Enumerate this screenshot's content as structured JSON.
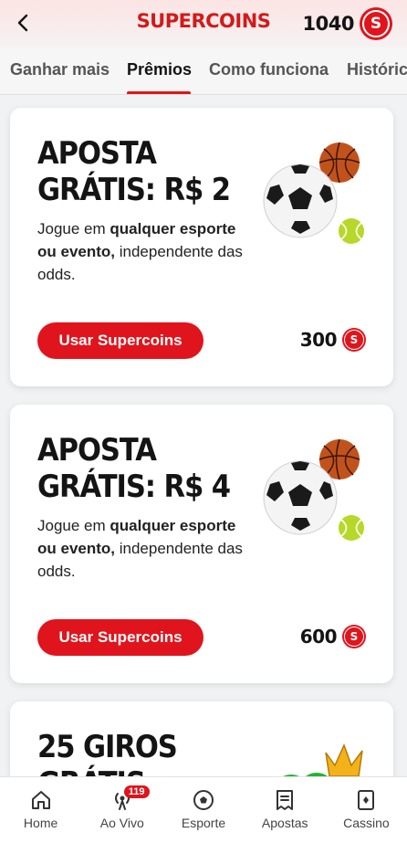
{
  "header": {
    "title": "SUPERCOINS",
    "balance": "1040",
    "coin_symbol": "S"
  },
  "tabs": [
    {
      "label": "Ganhar mais"
    },
    {
      "label": "Prêmios"
    },
    {
      "label": "Como funciona"
    },
    {
      "label": "Históric"
    }
  ],
  "active_tab": "Prêmios",
  "cards": [
    {
      "title_line1": "APOSTA",
      "title_line2": "GRÁTIS: R$ 2",
      "desc_prefix": "Jogue em ",
      "desc_bold": "qualquer esporte ou evento,",
      "desc_suffix": " independente das odds.",
      "button": "Usar Supercoins",
      "price": "300",
      "image": "sports-balls-icon"
    },
    {
      "title_line1": "APOSTA",
      "title_line2": "GRÁTIS: R$ 4",
      "desc_prefix": "Jogue em ",
      "desc_bold": "qualquer esporte ou evento,",
      "desc_suffix": " independente das odds.",
      "button": "Usar Supercoins",
      "price": "600",
      "image": "sports-balls-icon"
    },
    {
      "title_line1": "25 GIROS",
      "title_line2": "GRÁTIS",
      "image": "clover-crown-icon"
    }
  ],
  "bottom_nav": [
    {
      "label": "Home",
      "icon": "home-icon"
    },
    {
      "label": "Ao Vivo",
      "icon": "live-icon",
      "badge": "119"
    },
    {
      "label": "Esporte",
      "icon": "soccer-ball-icon"
    },
    {
      "label": "Apostas",
      "icon": "bet-slip-icon"
    },
    {
      "label": "Cassino",
      "icon": "card-icon"
    }
  ],
  "colors": {
    "brand": "#e0141c",
    "title": "#d21a1a"
  }
}
